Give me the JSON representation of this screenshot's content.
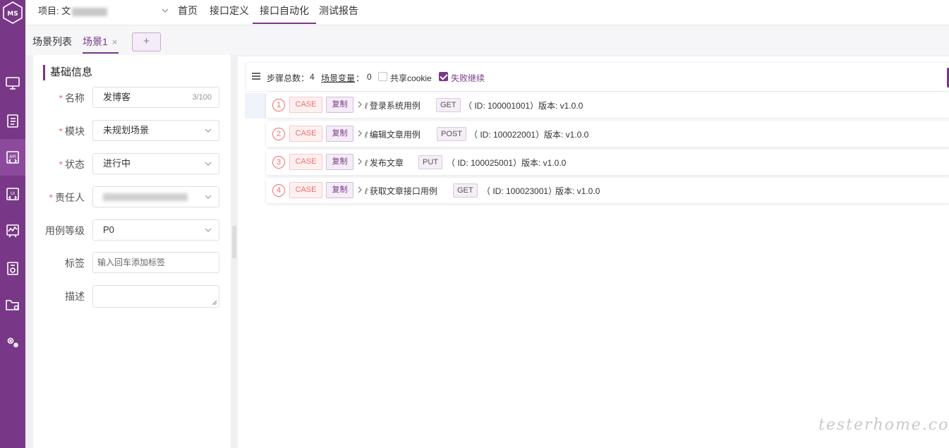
{
  "rail": {
    "items": [
      {
        "name": "monitor-icon"
      },
      {
        "name": "clipboard-icon"
      },
      {
        "name": "api-icon",
        "active": true
      },
      {
        "name": "ui-icon"
      },
      {
        "name": "performance-icon"
      },
      {
        "name": "report-icon"
      },
      {
        "name": "folder-icon"
      },
      {
        "name": "settings-icon"
      }
    ],
    "accent": "#783887"
  },
  "topbar": {
    "project_label": "项目: 文",
    "tabs": [
      "首页",
      "接口定义",
      "接口自动化",
      "测试报告"
    ],
    "active_tab": "接口自动化"
  },
  "scenebar": {
    "list_label": "场景列表",
    "tab_label": "场景1",
    "close_glyph": "×",
    "add_glyph": "+"
  },
  "form": {
    "title": "基础信息",
    "name_label": "名称",
    "name_value": "发博客",
    "name_count": "3/100",
    "module_label": "模块",
    "module_value": "未规划场景",
    "status_label": "状态",
    "status_value": "进行中",
    "owner_label": "责任人",
    "owner_value": "wulingling (wulingling)",
    "level_label": "用例等级",
    "level_value": "P0",
    "tags_label": "标签",
    "tags_placeholder": "输入回车添加标签",
    "desc_label": "描述",
    "required_mark": "*"
  },
  "stepbar": {
    "total_label": "步骤总数：",
    "total_value": "4",
    "vars_label": "场景变量",
    "vars_sep": "：",
    "vars_value": "0",
    "share_cookie": "共享cookie",
    "share_cookie_checked": false,
    "fail_continue": "失败继续",
    "fail_continue_checked": true
  },
  "steps": [
    {
      "num": "1",
      "type": "CASE",
      "copy": "复制",
      "name": "登录系统用例",
      "method": "GET",
      "id_text": "（ ID: 100001001）",
      "version": "版本: v1.0.0"
    },
    {
      "num": "2",
      "type": "CASE",
      "copy": "复制",
      "name": "编辑文章用例",
      "method": "POST",
      "id_text": "（ ID: 100022001）",
      "version": "版本: v1.0.0"
    },
    {
      "num": "3",
      "type": "CASE",
      "copy": "复制",
      "name": "发布文章",
      "method": "PUT",
      "id_text": "（ ID: 100025001）",
      "version": "版本: v1.0.0"
    },
    {
      "num": "4",
      "type": "CASE",
      "copy": "复制",
      "name": "获取文章接口用例",
      "method": "GET",
      "id_text": "（ ID: 100023001）",
      "version": "版本: v1.0.0"
    }
  ],
  "watermark": "testerhome.com"
}
